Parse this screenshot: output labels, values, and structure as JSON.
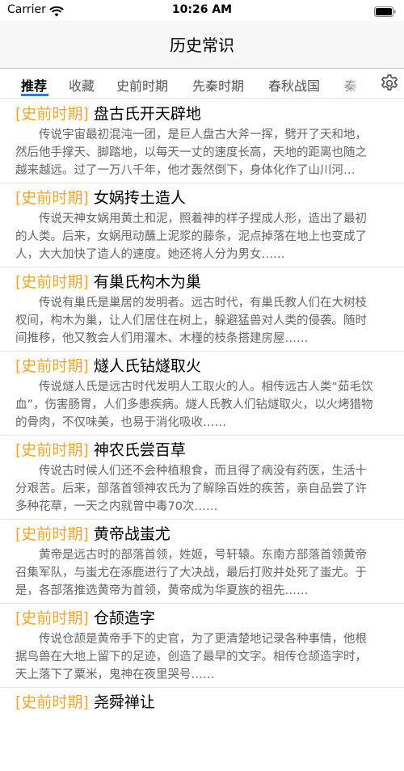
{
  "status_bar": {
    "carrier": "Carrier",
    "time": "10:26 AM"
  },
  "nav": {
    "title": "历史常识"
  },
  "tabs": [
    {
      "label": "推荐",
      "active": true
    },
    {
      "label": "收藏"
    },
    {
      "label": "史前时期"
    },
    {
      "label": "先秦时期"
    },
    {
      "label": "春秋战国"
    },
    {
      "label": "秦"
    }
  ],
  "icons": {
    "settings": "gear-icon",
    "wifi": "wifi-icon",
    "battery": "battery-icon"
  },
  "colors": {
    "category": "#f5a623",
    "tab_indicator": "#3a78d8",
    "body_text": "#666666"
  },
  "articles": [
    {
      "category": "[史前时期]",
      "title": "盘古氏开天辟地",
      "body": "传说宇宙最初混沌一团，是巨人盘古大斧一挥，劈开了天和地，然后他手撑天、脚踏地，以每天一丈的速度长高，天地的距离也随之越来越远。过了一万八千年，他才轰然倒下，身体化作了山川河流……"
    },
    {
      "category": "[史前时期]",
      "title": "女娲抟土造人",
      "body": "传说天神女娲用黄土和泥，照着神的样子捏成人形，造出了最初的人类。后来，女娲甩动蘸上泥浆的藤条，泥点掉落在地上也变成了人，大大加快了造人的速度。她还将人分为男女……"
    },
    {
      "category": "[史前时期]",
      "title": "有巢氏构木为巢",
      "body": "传说有巢氏是巢居的发明者。远古时代，有巢氏教人们在大树枝杈间，构木为巢，让人们居住在树上，躲避猛兽对人类的侵袭。随时间推移，他又教会人们用灌木、木槿的枝条搭建房屋……"
    },
    {
      "category": "[史前时期]",
      "title": "燧人氏钻燧取火",
      "body": "传说燧人氏是远古时代发明人工取火的人。相传远古人类“茹毛饮血”，伤害肠胃，人们多患疾病。燧人氏教人们钻燧取火，以火烤猎物的骨肉，不仅味美，也易于消化吸收……"
    },
    {
      "category": "[史前时期]",
      "title": "神农氏尝百草",
      "body": "传说古时候人们还不会种植粮食，而且得了病没有药医，生活十分艰苦。后来，部落首领神农氏为了解除百姓的疾苦，亲自品尝了许多种花草，一天之内就曾中毒70次……"
    },
    {
      "category": "[史前时期]",
      "title": "黄帝战蚩尤",
      "body": "黄帝是远古时的部落首领，姓姬，号轩辕。东南方部落首领黄帝召集军队，与蚩尤在涿鹿进行了大决战，最后打败并处死了蚩尤。于是，各部落推选黄帝为首领，黄帝成为华夏族的祖先……"
    },
    {
      "category": "[史前时期]",
      "title": "仓颉造字",
      "body": "传说仓颉是黄帝手下的史官，为了更清楚地记录各种事情，他根据鸟兽在大地上留下的足迹，创造了最早的文字。相传仓颉造字时，天上落下了粟米，鬼神在夜里哭号……"
    },
    {
      "category": "[史前时期]",
      "title": "尧舜禅让",
      "body": ""
    }
  ]
}
